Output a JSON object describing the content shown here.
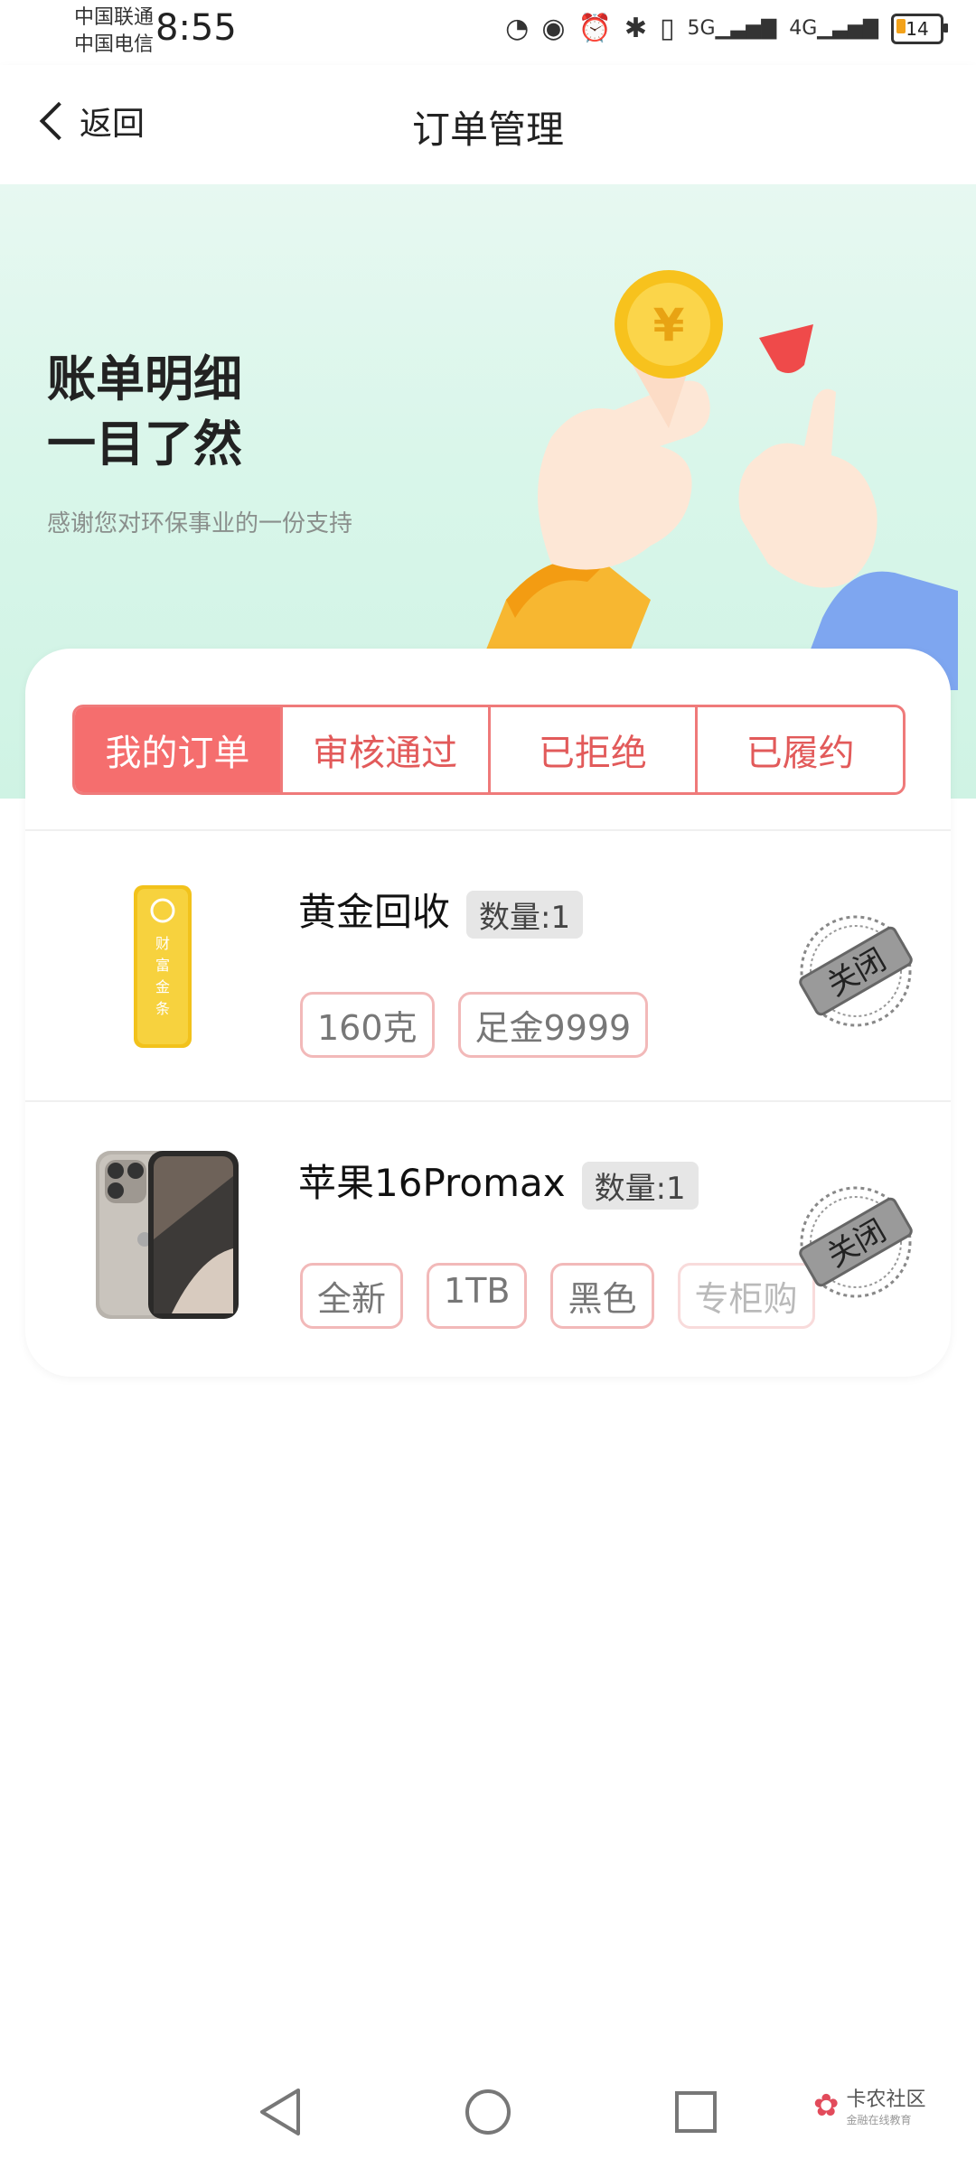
{
  "status_bar": {
    "carrier1": "中国联通",
    "carrier2": "中国电信",
    "time": "8:55",
    "battery": "14",
    "icons": [
      "speed-icon",
      "eye-icon",
      "alarm-icon",
      "bluetooth-icon",
      "vibrate-icon",
      "signal-5g-icon",
      "signal-4g-icon",
      "battery-icon"
    ]
  },
  "nav": {
    "back_label": "返回",
    "title": "订单管理"
  },
  "banner": {
    "title_line1": "账单明细",
    "title_line2": "一目了然",
    "subtitle": "感谢您对环保事业的一份支持"
  },
  "tabs": [
    {
      "label": "我的订单",
      "active": true
    },
    {
      "label": "审核通过",
      "active": false
    },
    {
      "label": "已拒绝",
      "active": false
    },
    {
      "label": "已履约",
      "active": false
    }
  ],
  "orders": [
    {
      "title": "黄金回收",
      "qty": "数量:1",
      "tags": [
        "160克",
        "足金9999"
      ],
      "status": "关闭",
      "image_text": "财富金条"
    },
    {
      "title": "苹果16Promax",
      "qty": "数量:1",
      "tags": [
        "全新",
        "1TB",
        "黑色",
        "专柜购"
      ],
      "status": "关闭"
    }
  ],
  "bottom_nav": {
    "watermark": "卡农社区",
    "watermark_sub": "金融在线教育"
  },
  "colors": {
    "accent": "#f56e6e",
    "tab_border": "#ef7a7a",
    "banner_bg": "#d9f6ea"
  }
}
